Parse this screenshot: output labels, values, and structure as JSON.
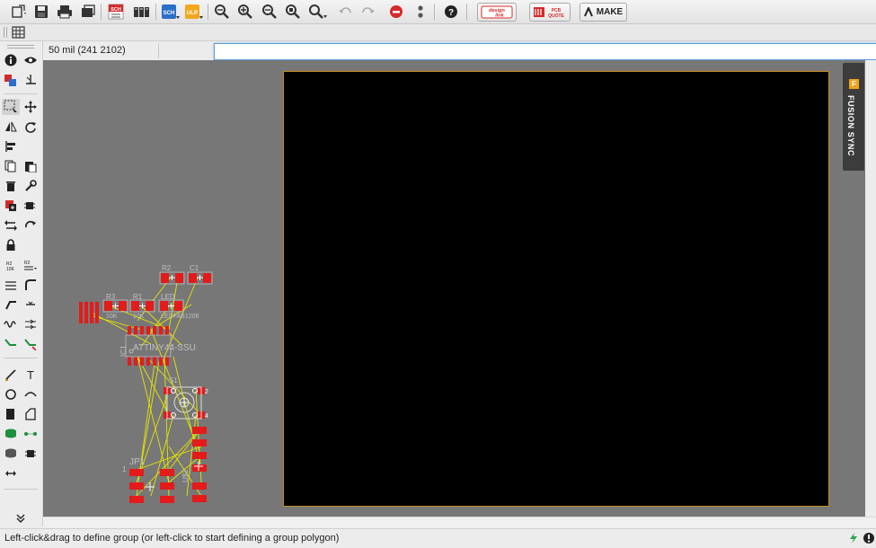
{
  "toolbar": {
    "design_link": {
      "line1": "design",
      "line2": "link"
    },
    "pcb_quote": {
      "line1": "PCB",
      "line2": "QUOTE"
    },
    "make": "MAKE",
    "sch_label": "SCH",
    "ulp_label": "ULP"
  },
  "command": {
    "coordinate": "50 mil (241 2102)",
    "input_value": ""
  },
  "side_panel": {
    "label": "FUSION SYNC",
    "badge": "F"
  },
  "status": {
    "text": "Left-click&drag to define group (or left-click to start defining a group polygon)"
  },
  "pcb": {
    "parts": [
      {
        "name": "R2"
      },
      {
        "name": "C1"
      },
      {
        "name": "R3"
      },
      {
        "name": "R1"
      },
      {
        "name": "LED1",
        "shown_as": "LED"
      }
    ],
    "values": [
      "10K",
      "10K",
      "LEDFAB1206"
    ],
    "ic_name": "ATTINY44-SSU",
    "ic_ref": "IC1",
    "switch_ref": "S1",
    "switch_pins": [
      "2",
      "4"
    ],
    "jp_ref": "JP1",
    "jp_pin1": "1",
    "u_ref": "U$2"
  },
  "colors": {
    "canvas": "#777777",
    "board": "#000000",
    "board_outline": "#c58a1e",
    "pad": "#e31b1b",
    "airwire": "#e6e600"
  }
}
